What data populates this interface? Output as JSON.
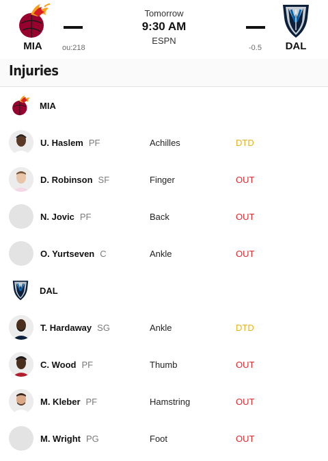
{
  "game": {
    "home": {
      "abbr": "MIA",
      "odds": "ou:218",
      "logo": "miami-heat-logo"
    },
    "away": {
      "abbr": "DAL",
      "odds": "-0.5",
      "logo": "dallas-mavericks-logo"
    },
    "day": "Tomorrow",
    "time": "9:30 AM",
    "network": "ESPN"
  },
  "section_title": "Injuries",
  "teams": [
    {
      "abbr": "MIA",
      "players": [
        {
          "name": "U. Haslem",
          "pos": "PF",
          "injury": "Achilles",
          "status": "DTD",
          "photo": true
        },
        {
          "name": "D. Robinson",
          "pos": "SF",
          "injury": "Finger",
          "status": "OUT",
          "photo": true
        },
        {
          "name": "N. Jovic",
          "pos": "PF",
          "injury": "Back",
          "status": "OUT",
          "photo": false
        },
        {
          "name": "O. Yurtseven",
          "pos": "C",
          "injury": "Ankle",
          "status": "OUT",
          "photo": false
        }
      ]
    },
    {
      "abbr": "DAL",
      "players": [
        {
          "name": "T. Hardaway",
          "pos": "SG",
          "injury": "Ankle",
          "status": "DTD",
          "photo": true
        },
        {
          "name": "C. Wood",
          "pos": "PF",
          "injury": "Thumb",
          "status": "OUT",
          "photo": true
        },
        {
          "name": "M. Kleber",
          "pos": "PF",
          "injury": "Hamstring",
          "status": "OUT",
          "photo": true
        },
        {
          "name": "M. Wright",
          "pos": "PG",
          "injury": "Foot",
          "status": "OUT",
          "photo": false
        }
      ]
    }
  ],
  "colors": {
    "dtd": "#e8b31a",
    "out": "#e0282c"
  }
}
